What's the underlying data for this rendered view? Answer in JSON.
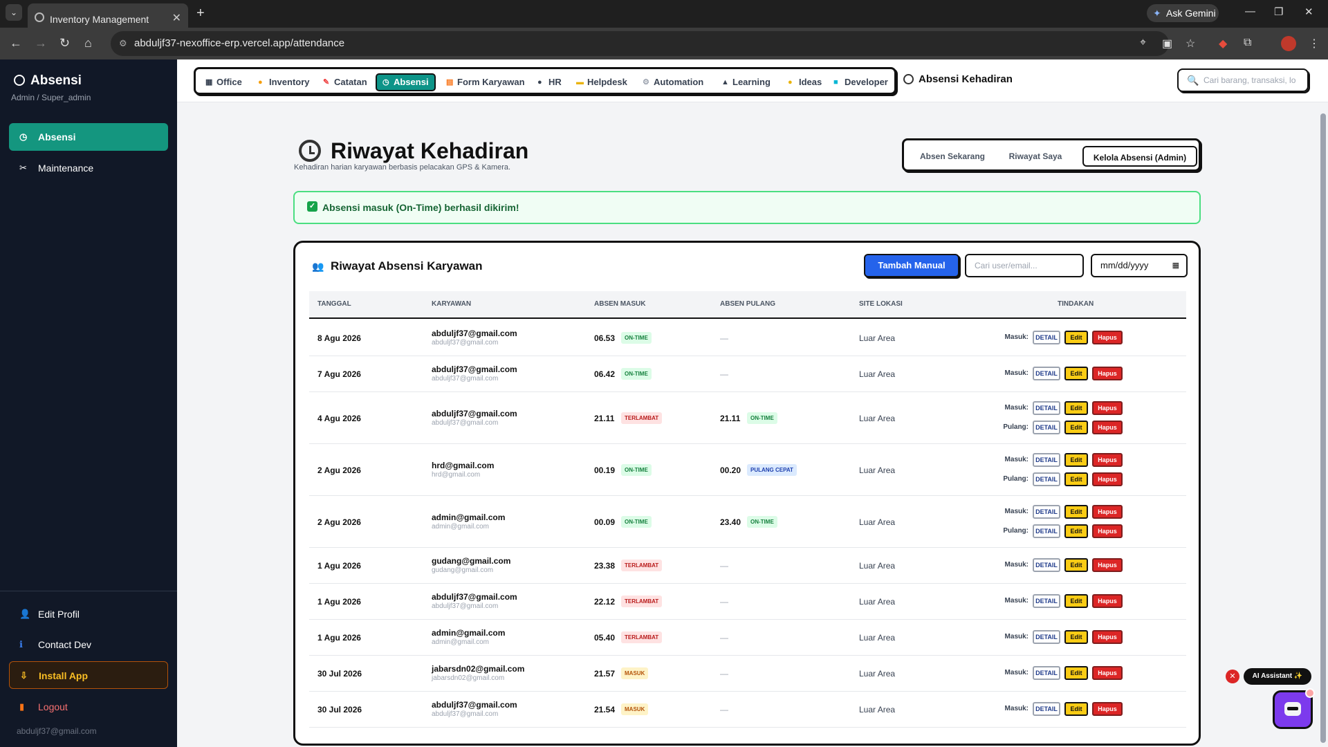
{
  "browser": {
    "tab_title": "Inventory Management",
    "url": "abduljf37-nexoffice-erp.vercel.app/attendance",
    "gemini_label": "Ask Gemini"
  },
  "sidebar": {
    "title": "Absensi",
    "role": "Admin / Super_admin",
    "items": [
      {
        "label": "Absensi",
        "icon": "clock-icon"
      },
      {
        "label": "Maintenance",
        "icon": "tools-icon"
      }
    ],
    "bottom": {
      "edit_profile": "Edit Profil",
      "contact_dev": "Contact Dev",
      "install_app": "Install App",
      "logout": "Logout",
      "email": "abduljf37@gmail.com"
    }
  },
  "topnav": {
    "links": [
      "Office",
      "Inventory",
      "Catatan",
      "Absensi",
      "Form Karyawan",
      "HR",
      "Helpdesk",
      "Automation",
      "Learning",
      "Ideas",
      "Developer"
    ],
    "active": "Absensi",
    "page_title": "Absensi Kehadiran",
    "search_placeholder": "Cari barang, transaksi, lo"
  },
  "header": {
    "title": "Riwayat Kehadiran",
    "subtitle": "Kehadiran harian karyawan berbasis pelacakan GPS & Kamera.",
    "segments": [
      "Absen Sekarang",
      "Riwayat Saya",
      "Kelola Absensi (Admin)"
    ],
    "active_segment": "Kelola Absensi (Admin)"
  },
  "alert": {
    "text": "Absensi masuk (On-Time) berhasil dikirim!"
  },
  "card": {
    "title": "Riwayat Absensi Karyawan",
    "add_button": "Tambah Manual",
    "user_placeholder": "Cari user/email...",
    "date_placeholder": "mm/dd/yyyy",
    "columns": [
      "TANGGAL",
      "KARYAWAN",
      "ABSEN MASUK",
      "ABSEN PULANG",
      "SITE LOKASI",
      "TINDAKAN"
    ],
    "action_labels": {
      "in": "Masuk:",
      "out": "Pulang:",
      "detail": "DETAIL",
      "edit": "Edit",
      "delete": "Hapus"
    },
    "dash": "—",
    "rows": [
      {
        "date": "8 Agu 2026",
        "name": "abduljf37@gmail.com",
        "email": "abduljf37@gmail.com",
        "in_time": "06.53",
        "in_status": "ON-TIME",
        "out_time": "",
        "out_status": "",
        "site": "Luar Area"
      },
      {
        "date": "7 Agu 2026",
        "name": "abduljf37@gmail.com",
        "email": "abduljf37@gmail.com",
        "in_time": "06.42",
        "in_status": "ON-TIME",
        "out_time": "",
        "out_status": "",
        "site": "Luar Area"
      },
      {
        "date": "4 Agu 2026",
        "name": "abduljf37@gmail.com",
        "email": "abduljf37@gmail.com",
        "in_time": "21.11",
        "in_status": "TERLAMBAT",
        "out_time": "21.11",
        "out_status": "ON-TIME",
        "site": "Luar Area"
      },
      {
        "date": "2 Agu 2026",
        "name": "hrd@gmail.com",
        "email": "hrd@gmail.com",
        "in_time": "00.19",
        "in_status": "ON-TIME",
        "out_time": "00.20",
        "out_status": "PULANG CEPAT",
        "site": "Luar Area"
      },
      {
        "date": "2 Agu 2026",
        "name": "admin@gmail.com",
        "email": "admin@gmail.com",
        "in_time": "00.09",
        "in_status": "ON-TIME",
        "out_time": "23.40",
        "out_status": "ON-TIME",
        "site": "Luar Area"
      },
      {
        "date": "1 Agu 2026",
        "name": "gudang@gmail.com",
        "email": "gudang@gmail.com",
        "in_time": "23.38",
        "in_status": "TERLAMBAT",
        "out_time": "",
        "out_status": "",
        "site": "Luar Area"
      },
      {
        "date": "1 Agu 2026",
        "name": "abduljf37@gmail.com",
        "email": "abduljf37@gmail.com",
        "in_time": "22.12",
        "in_status": "TERLAMBAT",
        "out_time": "",
        "out_status": "",
        "site": "Luar Area"
      },
      {
        "date": "1 Agu 2026",
        "name": "admin@gmail.com",
        "email": "admin@gmail.com",
        "in_time": "05.40",
        "in_status": "TERLAMBAT",
        "out_time": "",
        "out_status": "",
        "site": "Luar Area"
      },
      {
        "date": "30 Jul 2026",
        "name": "jabarsdn02@gmail.com",
        "email": "jabarsdn02@gmail.com",
        "in_time": "21.57",
        "in_status": "MASUK",
        "out_time": "",
        "out_status": "",
        "site": "Luar Area"
      },
      {
        "date": "30 Jul 2026",
        "name": "abduljf37@gmail.com",
        "email": "abduljf37@gmail.com",
        "in_time": "21.54",
        "in_status": "MASUK",
        "out_time": "",
        "out_status": "",
        "site": "Luar Area"
      }
    ]
  },
  "assistant": {
    "label": "AI Assistant ✨"
  },
  "colors": {
    "accent": "#14967f",
    "primary": "#2563eb",
    "danger": "#dc2626",
    "warning": "#facc15"
  }
}
